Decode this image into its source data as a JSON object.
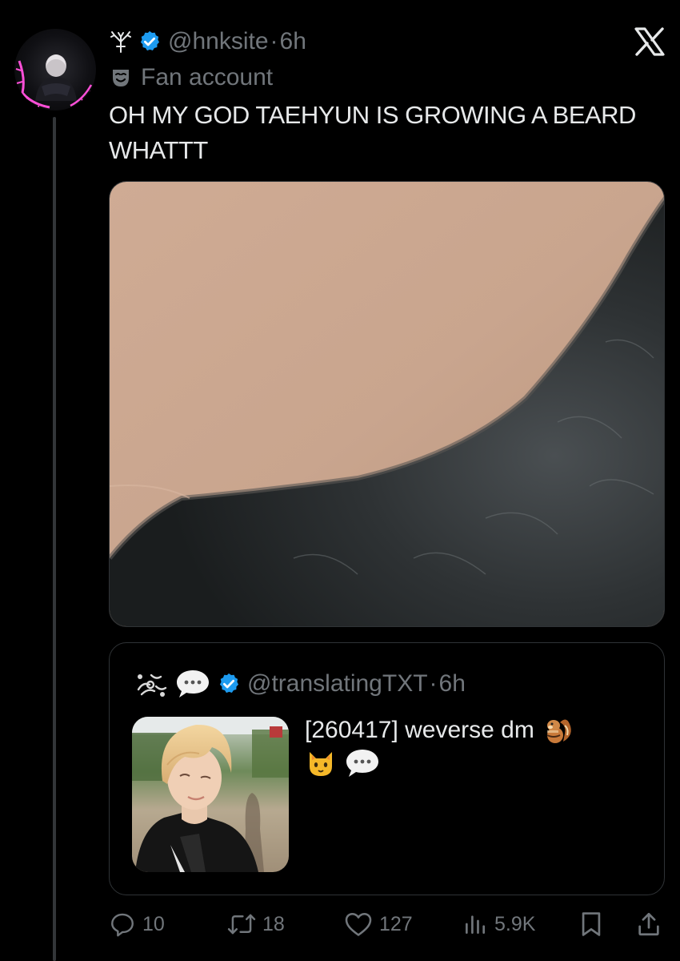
{
  "tweet": {
    "author_glyph": "✦",
    "handle": "@hnksite",
    "separator": "·",
    "time": "6h",
    "label_icon": "mask-icon",
    "label": "Fan account",
    "text": "OH MY GOD TAEHYUN IS GROWING A BEARD WHATTT",
    "media_icon": "photo-closeup"
  },
  "quote": {
    "handle": "@translatingTXT",
    "separator": "·",
    "time": "6h",
    "text_line1": "[260417] weverse dm",
    "emoji_1": "chipmunk-emoji",
    "emoji_2": "cat-face-emoji",
    "emoji_3": "speech-bubble-emoji"
  },
  "actions": {
    "replies": "10",
    "retweets": "18",
    "likes": "127",
    "views": "5.9K"
  },
  "colors": {
    "background": "#000000",
    "text": "#e7e9ea",
    "muted": "#71767b",
    "verified": "#1d9bf0",
    "border": "#2f3336"
  },
  "icons": {
    "close": "x-logo-icon",
    "verified": "verified-badge-icon",
    "reply": "reply-icon",
    "retweet": "retweet-icon",
    "like": "heart-icon",
    "views": "views-icon",
    "bookmark": "bookmark-icon",
    "share": "share-icon"
  }
}
